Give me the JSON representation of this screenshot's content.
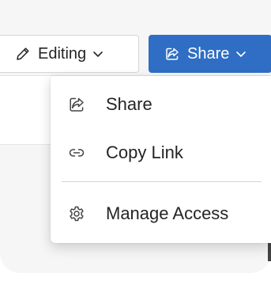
{
  "toolbar": {
    "editing_label": "Editing",
    "share_label": "Share"
  },
  "menu": {
    "items": [
      {
        "label": "Share",
        "icon": "share-icon"
      },
      {
        "label": "Copy Link",
        "icon": "link-icon"
      },
      {
        "label": "Manage Access",
        "icon": "gear-icon"
      }
    ]
  },
  "colors": {
    "share_button_bg": "#2f6ec4",
    "menu_bg": "#ffffff",
    "text": "#242424"
  }
}
